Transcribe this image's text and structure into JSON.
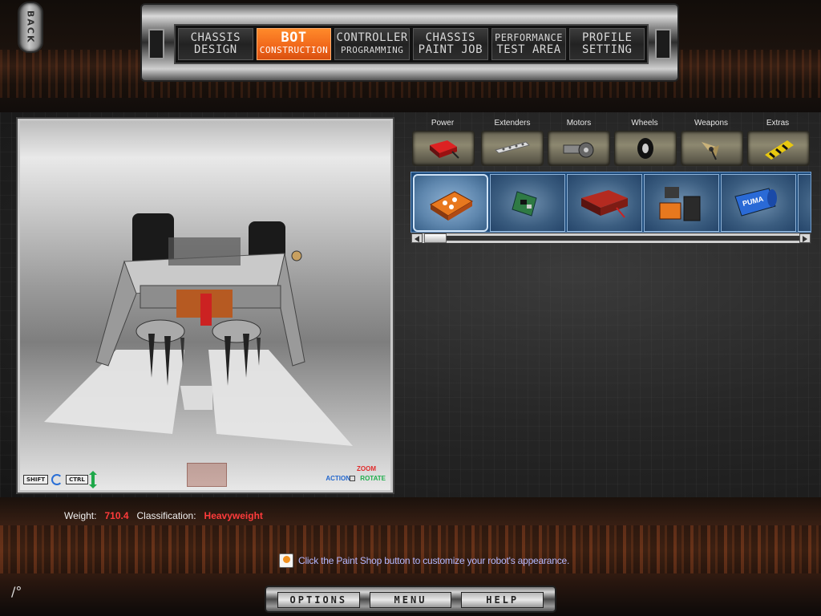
{
  "back_button": {
    "label": "BACK"
  },
  "tabs": [
    {
      "line1": "CHASSIS",
      "line2": "DESIGN",
      "active": false
    },
    {
      "line1": "BOT",
      "line2": "CONSTRUCTION",
      "active": true
    },
    {
      "line1": "CONTROLLER",
      "line2": "PROGRAMMING",
      "active": false
    },
    {
      "line1": "CHASSIS",
      "line2": "PAINT JOB",
      "active": false
    },
    {
      "line1": "PERFORMANCE",
      "line2": "TEST AREA",
      "active": false
    },
    {
      "line1": "PROFILE",
      "line2": "SETTING",
      "active": false
    }
  ],
  "viewport": {
    "controls": {
      "shift_key": "SHIFT",
      "ctrl_key": "CTRL"
    },
    "legend": {
      "zoom": "ZOOM",
      "action": "ACTION",
      "rotate": "ROTATE"
    }
  },
  "categories": [
    {
      "label": "Power",
      "icon": "battery-icon"
    },
    {
      "label": "Extenders",
      "icon": "extender-bar-icon"
    },
    {
      "label": "Motors",
      "icon": "motor-icon"
    },
    {
      "label": "Wheels",
      "icon": "wheel-icon"
    },
    {
      "label": "Weapons",
      "icon": "blade-weapon-icon"
    },
    {
      "label": "Extras",
      "icon": "hazard-extra-icon"
    }
  ],
  "parts": [
    {
      "icon": "orange-battery-pack-icon",
      "selected": true
    },
    {
      "icon": "green-circuit-board-icon",
      "selected": false
    },
    {
      "icon": "red-battery-box-icon",
      "selected": false
    },
    {
      "icon": "twin-batteries-icon",
      "selected": false
    },
    {
      "icon": "puma-battery-icon",
      "label": "PUMA",
      "selected": false
    }
  ],
  "scroll_position": 0.0,
  "status": {
    "weight_label": "Weight:",
    "weight_value": "710.4",
    "class_label": "Classification:",
    "class_value": "Heavyweight"
  },
  "tip": {
    "icon_label": "tips",
    "text": "Click the Paint Shop button to customize your robot's appearance."
  },
  "bottom_menu": [
    "OPTIONS",
    "MENU",
    "HELP"
  ],
  "colors": {
    "active_tab": "#f0661a",
    "status_value": "#ff3b3b",
    "tip_text": "#b3b8ff",
    "parts_strip": "#1d4a7a"
  }
}
